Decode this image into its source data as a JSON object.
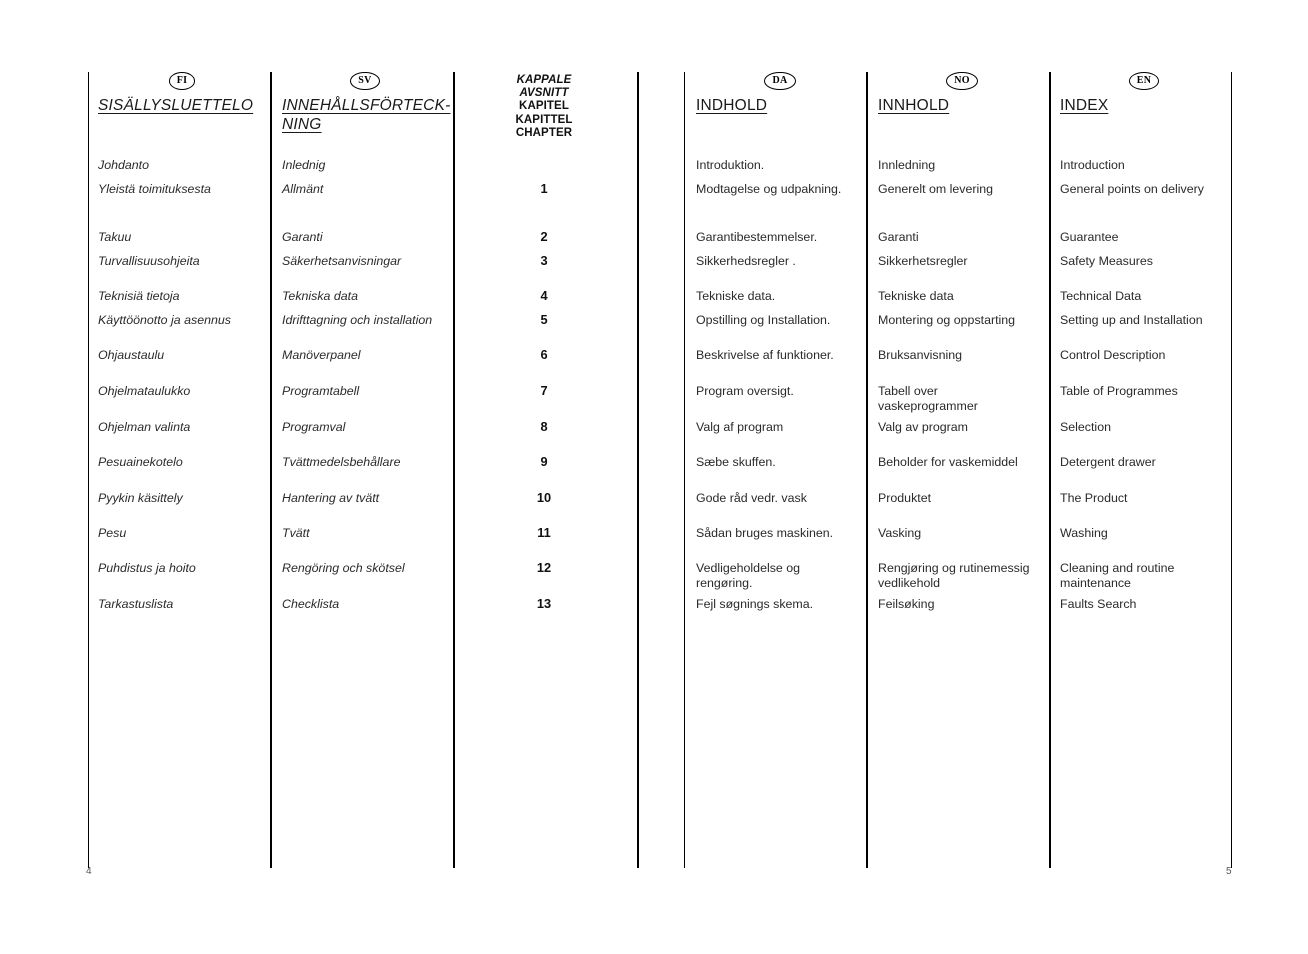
{
  "document": {
    "type": "manual-table-of-contents",
    "left_page_number": "4",
    "right_page_number": "5"
  },
  "chapter_header": {
    "lines": [
      "KAPPALE",
      "AVSNITT",
      "KAPITEL",
      "KAPITTEL",
      "CHAPTER"
    ],
    "line_fi": "KAPPALE",
    "line_sv": "AVSNITT",
    "line_da": "KAPITEL",
    "line_no": "KAPITTEL",
    "line_en": "CHAPTER"
  },
  "columns": [
    {
      "code": "FI",
      "badge": "FI",
      "title": "SISÄLLYSLUETTELO",
      "italic": true
    },
    {
      "code": "SV",
      "badge": "SV",
      "title": "INNEHÅLLSFÖRTECK-\nNING",
      "italic": true
    },
    {
      "code": "DA",
      "badge": "DA",
      "title": "INDHOLD",
      "italic": false
    },
    {
      "code": "NO",
      "badge": "NO",
      "title": "INNHOLD",
      "italic": false
    },
    {
      "code": "EN",
      "badge": "EN",
      "title": "INDEX",
      "italic": false
    }
  ],
  "entries": [
    {
      "chapter": "",
      "fi": "Johdanto",
      "sv": "Inlednig",
      "da": "Introduktion.",
      "no": "Innledning",
      "en": "Introduction"
    },
    {
      "chapter": "1",
      "fi": "Yleistä toimituksesta",
      "sv": "Allmänt",
      "da": "Modtagelse og udpakning.",
      "no": "Generelt om levering",
      "en": "General points on delivery"
    },
    {
      "chapter": "2",
      "fi": "Takuu",
      "sv": "Garanti",
      "da": "Garantibestemmelser.",
      "no": "Garanti",
      "en": "Guarantee"
    },
    {
      "chapter": "3",
      "fi": "Turvallisuusohjeita",
      "sv": "Säkerhetsanvisningar",
      "da": "Sikkerhedsregler .",
      "no": "Sikkerhetsregler",
      "en": "Safety Measures"
    },
    {
      "chapter": "4",
      "fi": "Teknisiä tietoja",
      "sv": "Tekniska data",
      "da": "Tekniske data.",
      "no": "Tekniske data",
      "en": "Technical Data"
    },
    {
      "chapter": "5",
      "fi": "Käyttöönotto ja asennus",
      "sv": "Idrifttagning och installation",
      "da": "Opstilling og Installation.",
      "no": "Montering og oppstarting",
      "en": "Setting up and Installation"
    },
    {
      "chapter": "6",
      "fi": "Ohjaustaulu",
      "sv": "Manöverpanel",
      "da": "Beskrivelse af funktioner.",
      "no": "Bruksanvisning",
      "en": "Control Description"
    },
    {
      "chapter": "7",
      "fi": "Ohjelmataulukko",
      "sv": "Programtabell",
      "da": "Program oversigt.",
      "no": "Tabell over\nvaskeprogrammer",
      "en": "Table of Programmes"
    },
    {
      "chapter": "8",
      "fi": "Ohjelman valinta",
      "sv": "Programval",
      "da": "Valg af program",
      "no": "Valg av program",
      "en": "Selection"
    },
    {
      "chapter": "9",
      "fi": "Pesuainekotelo",
      "sv": "Tvättmedelsbehållare",
      "da": "Sæbe skuffen.",
      "no": "Beholder for vaskemiddel",
      "en": "Detergent drawer"
    },
    {
      "chapter": "10",
      "fi": "Pyykin käsittely",
      "sv": "Hantering av tvätt",
      "da": "Gode råd vedr. vask",
      "no": "Produktet",
      "en": "The Product"
    },
    {
      "chapter": "11",
      "fi": "Pesu",
      "sv": "Tvätt",
      "da": "Sådan bruges maskinen.",
      "no": "Vasking",
      "en": "Washing"
    },
    {
      "chapter": "12",
      "fi": "Puhdistus ja hoito",
      "sv": "Rengöring och skötsel",
      "da": "Vedligeholdelse og\nrengøring.",
      "no": "Rengjøring og rutinemessig\nvedlikehold",
      "en": "Cleaning and routine\nmaintenance"
    },
    {
      "chapter": "13",
      "fi": "Tarkastuslista",
      "sv": "Checklista",
      "da": "Fejl søgnings skema.",
      "no": "Feilsøking",
      "en": "Faults Search"
    }
  ]
}
